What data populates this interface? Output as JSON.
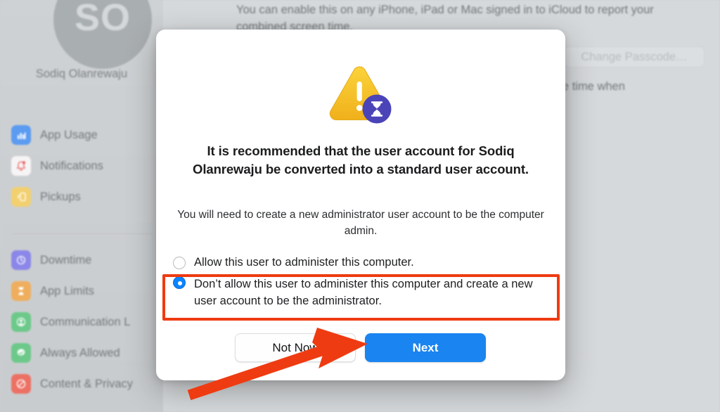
{
  "background": {
    "sidebar": {
      "avatar_initials": "SO",
      "user_name": "Sodiq Olanrewaju",
      "items_top": [
        {
          "label": "App Usage",
          "icon": "bar-chart-icon",
          "color": "#5b9bf0"
        },
        {
          "label": "Notifications",
          "icon": "bell-icon",
          "color": "#f5f3f4"
        },
        {
          "label": "Pickups",
          "icon": "pickup-phone-icon",
          "color": "#f2d070"
        }
      ],
      "items_bottom": [
        {
          "label": "Downtime",
          "icon": "downtime-clock-icon",
          "color": "#8b87e8"
        },
        {
          "label": "App Limits",
          "icon": "hourglass-icon",
          "color": "#eeae5d"
        },
        {
          "label": "Communication L",
          "icon": "person-circle-icon",
          "color": "#6cc98a"
        },
        {
          "label": "Always Allowed",
          "icon": "check-badge-icon",
          "color": "#6cc98a"
        },
        {
          "label": "Content & Privacy",
          "icon": "no-entry-icon",
          "color": "#ec7063"
        }
      ]
    },
    "content": {
      "description": "You can enable this on any iPhone, iPad or Mac signed in to iCloud to report your combined screen time.",
      "change_passcode_button": "Change Passcode…",
      "partial_text": "ow for more time when"
    }
  },
  "dialog": {
    "icon": "warning-triangle-with-hourglass-badge-icon",
    "headline": "It is recommended that the user account for Sodiq Olanrewaju be converted into a standard user account.",
    "subtext": "You will need to create a new administrator user account to be the computer admin.",
    "options": [
      {
        "label": "Allow this user to administer this computer.",
        "selected": false
      },
      {
        "label": "Don’t allow this user to administer this computer and create a new user account to be the administrator.",
        "selected": true
      }
    ],
    "buttons": {
      "secondary": "Not Now",
      "primary": "Next"
    }
  },
  "annotations": {
    "highlight_color": "#ef3b11",
    "arrow_color": "#ef3b11",
    "highlight_target": "second-radio-option",
    "arrow_target": "next-button"
  },
  "colors": {
    "accent_blue": "#1a84f0",
    "radio_blue": "#0a84ff",
    "warning_yellow": "#f5c518",
    "badge_purple": "#4b44b8"
  }
}
